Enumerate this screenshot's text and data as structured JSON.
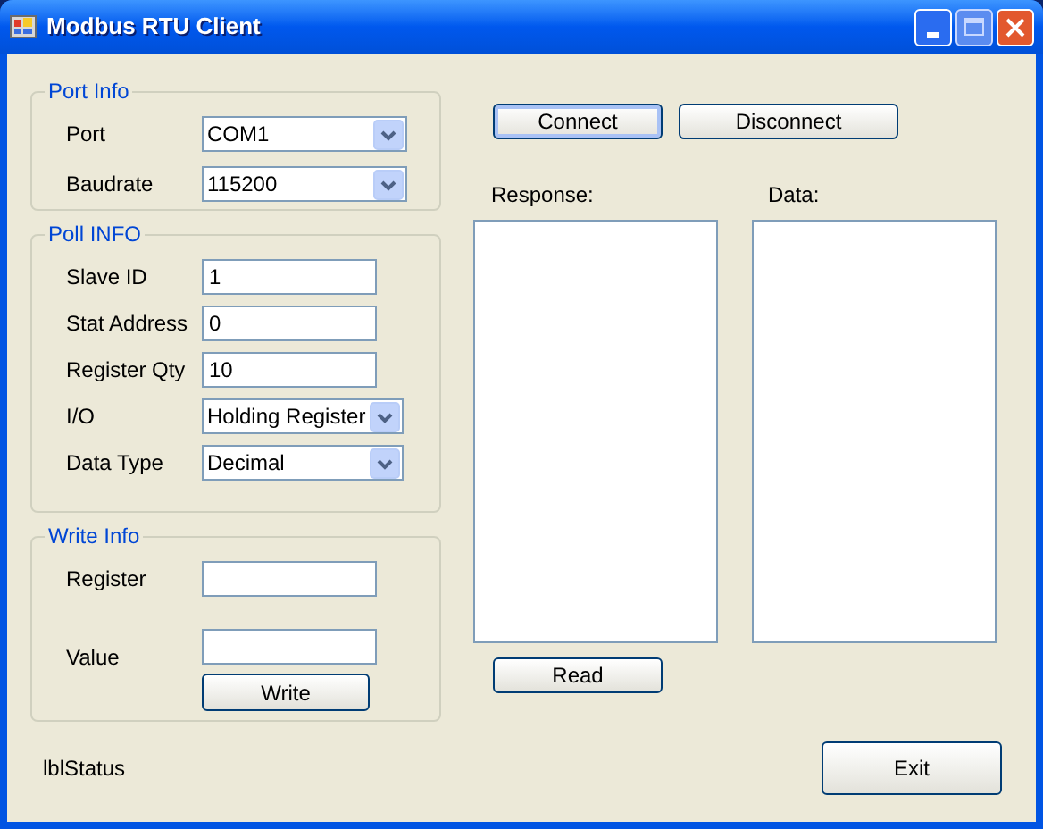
{
  "window": {
    "title": "Modbus RTU Client"
  },
  "groups": [
    {
      "legend": "Port Info",
      "fields": [
        {
          "label": "Port",
          "kind": "combo",
          "value": "COM1"
        },
        {
          "label": "Baudrate",
          "kind": "combo",
          "value": "115200"
        }
      ]
    },
    {
      "legend": "Poll INFO",
      "fields": [
        {
          "label": "Slave ID",
          "kind": "text",
          "value": "1"
        },
        {
          "label": "Stat Address",
          "kind": "text",
          "value": "0"
        },
        {
          "label": "Register Qty",
          "kind": "text",
          "value": "10"
        },
        {
          "label": "I/O",
          "kind": "combo",
          "value": "Holding Register"
        },
        {
          "label": "Data Type",
          "kind": "combo",
          "value": "Decimal"
        }
      ]
    },
    {
      "legend": "Write Info",
      "fields": [
        {
          "label": "Register",
          "kind": "text"
        },
        {
          "label": "Value",
          "kind": "text"
        }
      ],
      "button": "Write"
    }
  ],
  "top_buttons": [
    {
      "label": "Connect",
      "focused": true
    },
    {
      "label": "Disconnect",
      "focused": false
    }
  ],
  "panels": [
    {
      "label": "Response:"
    },
    {
      "label": "Data:"
    }
  ],
  "read_button": "Read",
  "status": "lblStatus",
  "exit_button": "Exit"
}
